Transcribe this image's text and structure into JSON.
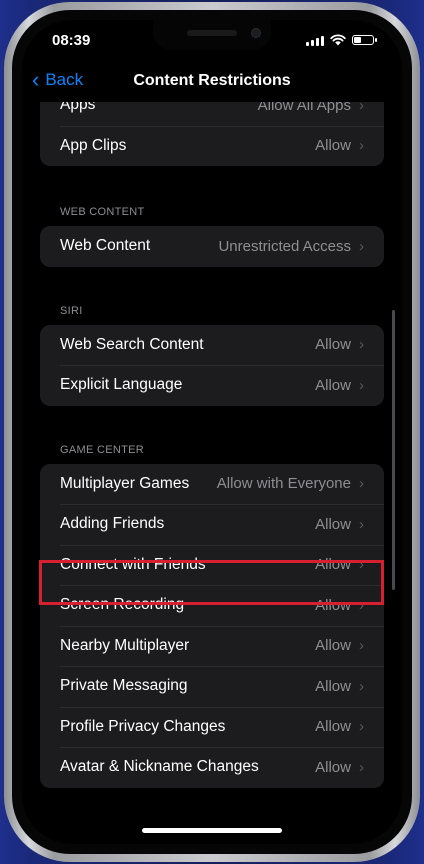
{
  "status_bar": {
    "time": "08:39"
  },
  "nav": {
    "back_label": "Back",
    "title": "Content Restrictions"
  },
  "top_group": [
    {
      "label": "Apps",
      "value": "Allow All Apps"
    },
    {
      "label": "App Clips",
      "value": "Allow"
    }
  ],
  "web_content": {
    "header": "WEB CONTENT",
    "items": [
      {
        "label": "Web Content",
        "value": "Unrestricted Access"
      }
    ]
  },
  "siri": {
    "header": "SIRI",
    "items": [
      {
        "label": "Web Search Content",
        "value": "Allow"
      },
      {
        "label": "Explicit Language",
        "value": "Allow"
      }
    ]
  },
  "game_center": {
    "header": "GAME CENTER",
    "items": [
      {
        "label": "Multiplayer Games",
        "value": "Allow with Everyone"
      },
      {
        "label": "Adding Friends",
        "value": "Allow"
      },
      {
        "label": "Connect with Friends",
        "value": "Allow"
      },
      {
        "label": "Screen Recording",
        "value": "Allow"
      },
      {
        "label": "Nearby Multiplayer",
        "value": "Allow"
      },
      {
        "label": "Private Messaging",
        "value": "Allow"
      },
      {
        "label": "Profile Privacy Changes",
        "value": "Allow"
      },
      {
        "label": "Avatar & Nickname Changes",
        "value": "Allow"
      }
    ]
  },
  "icons": {
    "chevron": "›",
    "back_chevron": "‹"
  },
  "colors": {
    "accent": "#0a84ff",
    "highlight": "#d62030",
    "cell_background": "#1c1c1e"
  },
  "battery_level": 0.35
}
